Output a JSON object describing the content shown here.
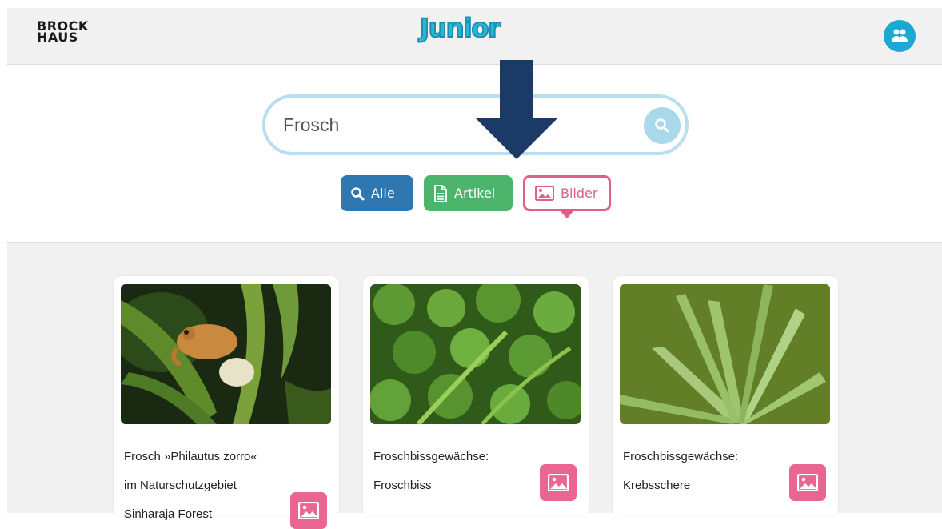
{
  "header": {
    "logo_line1": "BROCK",
    "logo_line2": "HAUS",
    "brand": "Junior"
  },
  "search": {
    "value": "Frosch",
    "placeholder": ""
  },
  "filters": [
    {
      "label": "Alle",
      "icon": "search-icon",
      "color": "#2e77b1",
      "active": false
    },
    {
      "label": "Artikel",
      "icon": "document-icon",
      "color": "#4db46b",
      "active": false
    },
    {
      "label": "Bilder",
      "icon": "image-icon",
      "color": "#e05f8a",
      "active": true
    }
  ],
  "results": [
    {
      "title_lines": [
        "Frosch »Philautus zorro«",
        "im Naturschutzgebiet",
        "Sinharaja Forest"
      ],
      "badge_icon": "image-icon"
    },
    {
      "title_lines": [
        "Froschbissgewächse:",
        "Froschbiss"
      ],
      "badge_icon": "image-icon"
    },
    {
      "title_lines": [
        "Froschbissgewächse:",
        "Krebsschere"
      ],
      "badge_icon": "image-icon"
    }
  ],
  "colors": {
    "accent_pink": "#e8668f",
    "accent_blue": "#2e77b1",
    "accent_green": "#4db46b",
    "brand_cyan": "#2bb6d6",
    "arrow": "#1b3a66"
  }
}
